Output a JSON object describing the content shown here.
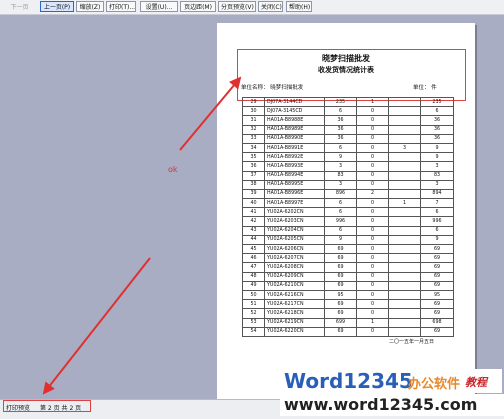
{
  "toolbar": {
    "buttons": [
      "下一页",
      "上一页(P)",
      "缩放(Z)",
      "打印(T)...",
      "设置(U)...",
      "页边距(M)",
      "分页预览(V)",
      "关闭(C)",
      "帮助(H)"
    ]
  },
  "report": {
    "title": "晓梦扫描批发",
    "subtitle": "收发货情况统计表",
    "unit_left": "单位名称：  晓梦扫描批发",
    "unit_right": "单位：  件",
    "rows": [
      [
        "29",
        "DJ07A-3144CD",
        "235",
        "1",
        "",
        "235"
      ],
      [
        "30",
        "DJ07A-3145CD",
        "6",
        "0",
        "",
        "6"
      ],
      [
        "31",
        "HA01A-B8988E",
        "36",
        "0",
        "",
        "36"
      ],
      [
        "32",
        "HA01A-B8989E",
        "36",
        "0",
        "",
        "36"
      ],
      [
        "33",
        "HA01A-B8990E",
        "36",
        "0",
        "",
        "36"
      ],
      [
        "34",
        "HA01A-B8991E",
        "6",
        "0",
        "3",
        "9"
      ],
      [
        "35",
        "HA01A-B8992E",
        "9",
        "0",
        "",
        "9"
      ],
      [
        "36",
        "HA01A-B8993E",
        "3",
        "0",
        "",
        "3"
      ],
      [
        "37",
        "HA01A-B8994E",
        "83",
        "0",
        "",
        "83"
      ],
      [
        "38",
        "HA01A-B8995E",
        "3",
        "0",
        "",
        "3"
      ],
      [
        "39",
        "HA01A-B8996E",
        "896",
        "2",
        "",
        "894"
      ],
      [
        "40",
        "HA01A-B8997E",
        "6",
        "0",
        "1",
        "7"
      ],
      [
        "41",
        "YU02A-6202CN",
        "6",
        "0",
        "",
        "6"
      ],
      [
        "42",
        "YU02A-6203CN",
        "996",
        "0",
        "",
        "996"
      ],
      [
        "43",
        "YU02A-6204CN",
        "6",
        "0",
        "",
        "6"
      ],
      [
        "44",
        "YU02A-6205CN",
        "9",
        "0",
        "",
        "9"
      ],
      [
        "45",
        "YU02A-6206CN",
        "69",
        "0",
        "",
        "69"
      ],
      [
        "46",
        "YU02A-6207CN",
        "69",
        "0",
        "",
        "69"
      ],
      [
        "47",
        "YU02A-6208CN",
        "69",
        "0",
        "",
        "69"
      ],
      [
        "48",
        "YU02A-6209CN",
        "69",
        "0",
        "",
        "69"
      ],
      [
        "49",
        "YU02A-6210CN",
        "69",
        "0",
        "",
        "69"
      ],
      [
        "50",
        "YU02A-6216CN",
        "95",
        "0",
        "",
        "95"
      ],
      [
        "51",
        "YU02A-6217CN",
        "69",
        "0",
        "",
        "69"
      ],
      [
        "52",
        "YU02A-6218CN",
        "69",
        "0",
        "",
        "69"
      ],
      [
        "53",
        "YU02A-6219CN",
        "699",
        "1",
        "",
        "698"
      ],
      [
        "54",
        "YU02A-6220CN",
        "69",
        "0",
        "",
        "69"
      ]
    ],
    "footer_date": "二〇一五年一月五日"
  },
  "annotation": {
    "label": "ok",
    "color": "#e03030"
  },
  "status": {
    "mode": "打印预览",
    "page": "第 2 页  共 2 页"
  },
  "watermark": {
    "brand": "Word12345",
    "tagline": "办公软件",
    "tag": "教程",
    "url": "www.word12345.com",
    "brand_color": "#2a5fb8"
  }
}
